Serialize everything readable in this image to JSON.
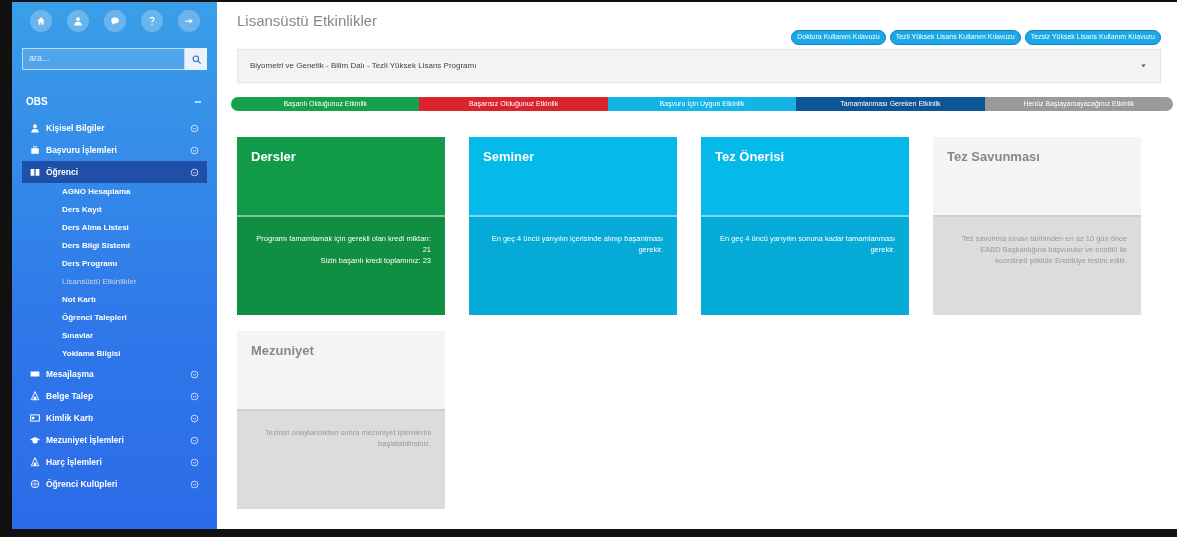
{
  "sidebar": {
    "search": {
      "placeholder": "ara..."
    },
    "section": {
      "title": "OBS",
      "expanded": true
    },
    "items": [
      {
        "label": "Kişisel Bilgiler",
        "expanded": false
      },
      {
        "label": "Başvuru İşlemleri",
        "expanded": false
      },
      {
        "label": "Öğrenci",
        "expanded": true,
        "children": [
          {
            "label": "AGNO Hesaplama",
            "selected": false
          },
          {
            "label": "Ders Kayıt",
            "selected": false
          },
          {
            "label": "Ders Alma Listesi",
            "selected": false
          },
          {
            "label": "Ders Bilgi Sistemi",
            "selected": false
          },
          {
            "label": "Ders Programı",
            "selected": false
          },
          {
            "label": "Lisansüstü Etkinlikler",
            "selected": true
          },
          {
            "label": "Not Kartı",
            "selected": false
          },
          {
            "label": "Öğrenci Talepleri",
            "selected": false
          },
          {
            "label": "Sınavlar",
            "selected": false
          },
          {
            "label": "Yoklama Bilgisi",
            "selected": false
          }
        ]
      },
      {
        "label": "Mesajlaşma",
        "expanded": false
      },
      {
        "label": "Belge Talep",
        "expanded": false
      },
      {
        "label": "Kimlik Kartı",
        "expanded": false
      },
      {
        "label": "Mezuniyet İşlemleri",
        "expanded": false
      },
      {
        "label": "Harç İşlemleri",
        "expanded": false
      },
      {
        "label": "Öğrenci Kulüpleri",
        "expanded": false
      }
    ]
  },
  "page": {
    "title": "Lisansüstü Etkinlikler",
    "guides": [
      "Doktora Kullanım Kılavuzu",
      "Tezli Yüksek Lisans Kullanım Kılavuzu",
      "Tezsiz Yüksek Lisans Kullanım Kılavuzu"
    ],
    "program_select": {
      "value": "Biyometri ve Genetik - Bilim Dalı - Tezli Yüksek Lisans Programı"
    },
    "legend": [
      {
        "label": "Başarılı Olduğunuz Etkinlik",
        "color": "#16a04c"
      },
      {
        "label": "Başarısız Olduğunuz Etkinlik",
        "color": "#d9232d"
      },
      {
        "label": "Başvuru İçin Uygun Etkinlik",
        "color": "#14b4e6"
      },
      {
        "label": "Tamamlanması Gereken Etkinlik",
        "color": "#0d5696"
      },
      {
        "label": "Henüz Başlayamayacağınız Etkinlik",
        "color": "#9a9a9a"
      }
    ],
    "activities": [
      {
        "title": "Dersler",
        "color": "#119a48",
        "lines": [
          "Programı tamamlamak için gerekli olan kredi miktarı: 21",
          "Sizin başarılı kredi toplamınız: 23"
        ]
      },
      {
        "title": "Seminer",
        "color": "#05b9ea",
        "lines": [
          "En geç 4 üncü yarıyılın içerisinde alınıp başarılması gerekir."
        ]
      },
      {
        "title": "Tez Önerisi",
        "color": "#05b9ea",
        "lines": [
          "En geç 4 üncü yarıyılın sonuna kadar tamamlanması gerekir."
        ]
      },
      {
        "title": "Tez Savunması",
        "color": "#f4f4f4",
        "lines": [
          "Tez savunma sınavı tarihinden en az 10 gün önce EABD Başkanlığına başvurulur ve enstitü ile koordineli şekilde Enstitüye teslim edilir."
        ]
      },
      {
        "title": "Mezuniyet",
        "color": "#f4f4f4",
        "lines": [
          "Tezinizi onaylandıktan sonra mezuniyet işlemlerini başlatabilirsiniz."
        ]
      }
    ]
  }
}
